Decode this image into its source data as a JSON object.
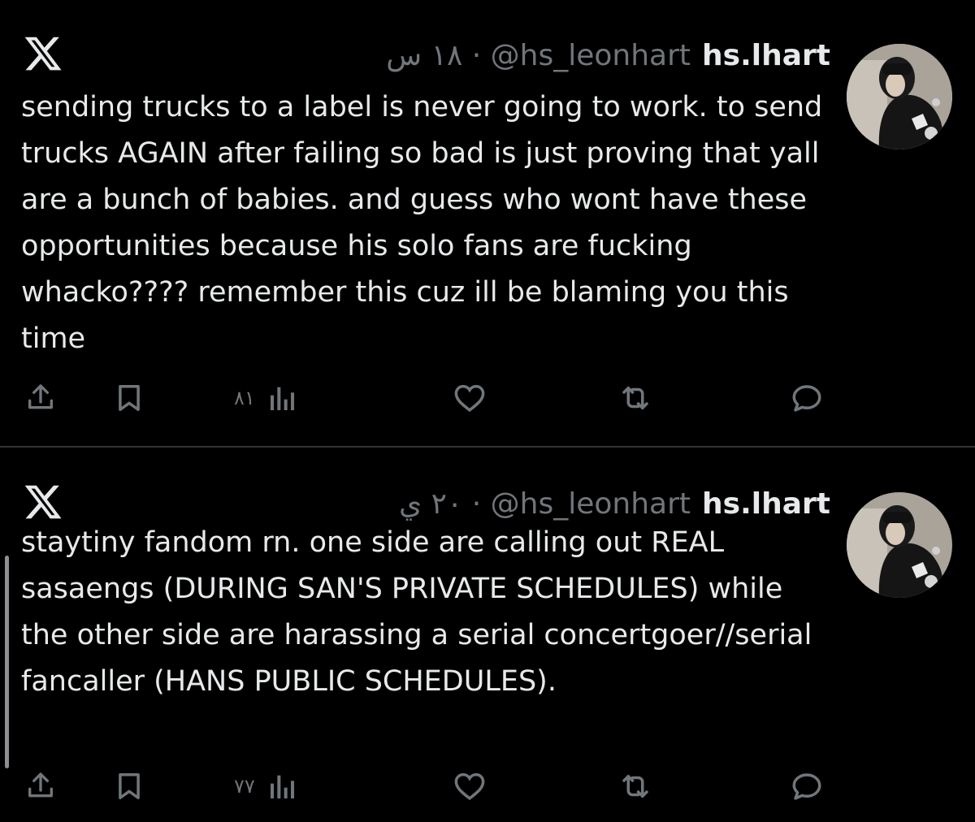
{
  "app": {
    "logo": "x-logo-icon"
  },
  "tweets": [
    {
      "display_name": "hs.lhart",
      "meta": "١٨ س · @hs_leonhart",
      "text": "sending trucks to a label is never going to work. to send trucks AGAIN after failing so bad is just proving that yall are a bunch of babies. and guess who wont have these opportunities because his solo fans are fucking whacko???? remember this cuz ill be blaming you this time",
      "views": "٨١",
      "actions": [
        "share-icon",
        "bookmark-icon",
        "views-icon",
        "like-icon",
        "retweet-icon",
        "reply-icon"
      ]
    },
    {
      "display_name": "hs.lhart",
      "meta": "٢٠ ي · @hs_leonhart",
      "text": "staytiny fandom rn. one side are calling out REAL sasaengs (DURING SAN'S PRIVATE SCHEDULES) while the other side are harassing a serial concertgoer//serial fancaller (HANS PUBLIC SCHEDULES).",
      "views": "٧٧",
      "actions": [
        "share-icon",
        "bookmark-icon",
        "views-icon",
        "like-icon",
        "retweet-icon",
        "reply-icon"
      ]
    }
  ],
  "colors": {
    "background": "#000000",
    "text": "#e7e9ea",
    "muted": "#71767b",
    "divider": "#2f3336"
  }
}
